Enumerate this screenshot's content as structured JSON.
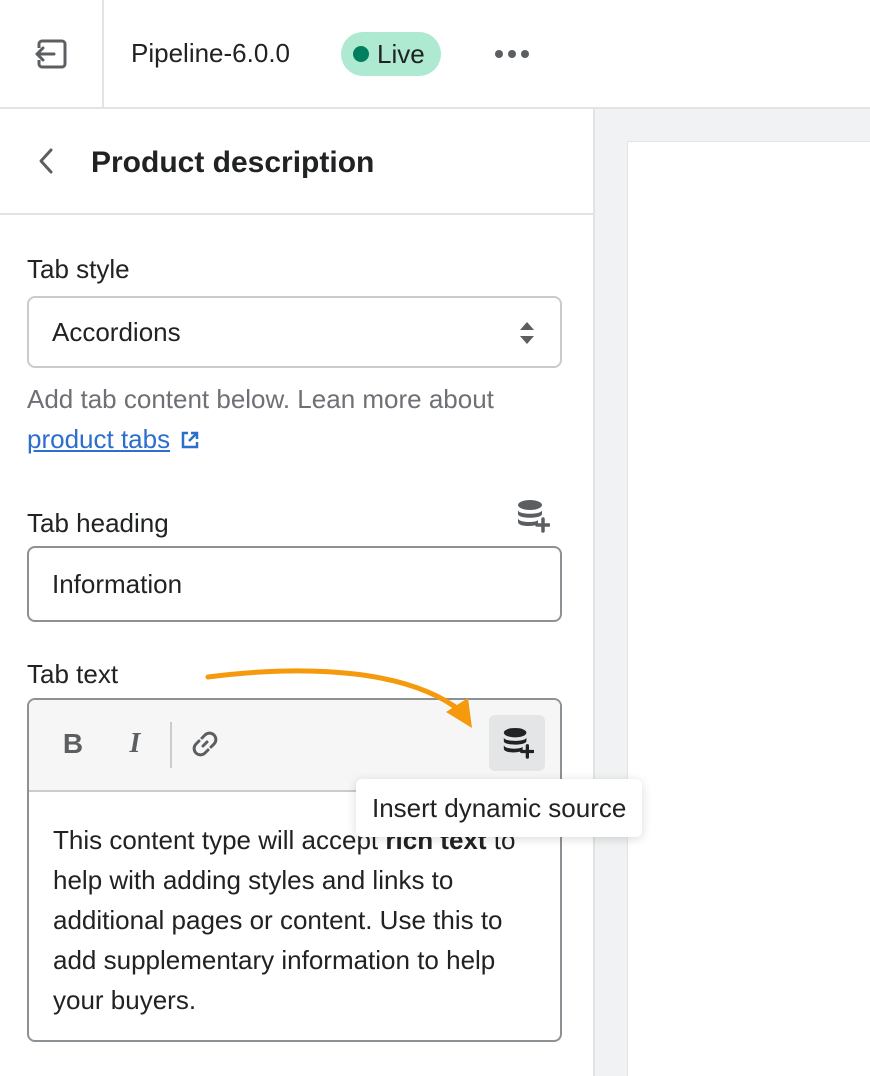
{
  "topbar": {
    "exit_icon": "exit-icon",
    "theme_name": "Pipeline-6.0.0",
    "status_badge": "Live",
    "status_color": "#007f5f",
    "more_icon": "more-horizontal-icon"
  },
  "panel": {
    "back_icon": "chevron-left-icon",
    "title": "Product description"
  },
  "fields": {
    "tab_style": {
      "label": "Tab style",
      "value": "Accordions"
    },
    "help": {
      "text": "Add tab content below. Lean more about",
      "link_text": "product tabs"
    },
    "tab_heading": {
      "label": "Tab heading",
      "value": "Information"
    },
    "tab_text": {
      "label": "Tab text",
      "toolbar": {
        "bold": "B",
        "italic": "I"
      },
      "content_before_bold": "This content type will accept ",
      "content_bold": "rich text",
      "content_after_bold": " to help with adding styles and links to additional pages or content. Use this to add supplementary information to help your buyers."
    }
  },
  "tooltip": {
    "text": "Insert dynamic source"
  },
  "colors": {
    "accent_link": "#2c6ecb",
    "badge_bg": "#aee9d1",
    "annotation_arrow": "#f59a0c"
  }
}
